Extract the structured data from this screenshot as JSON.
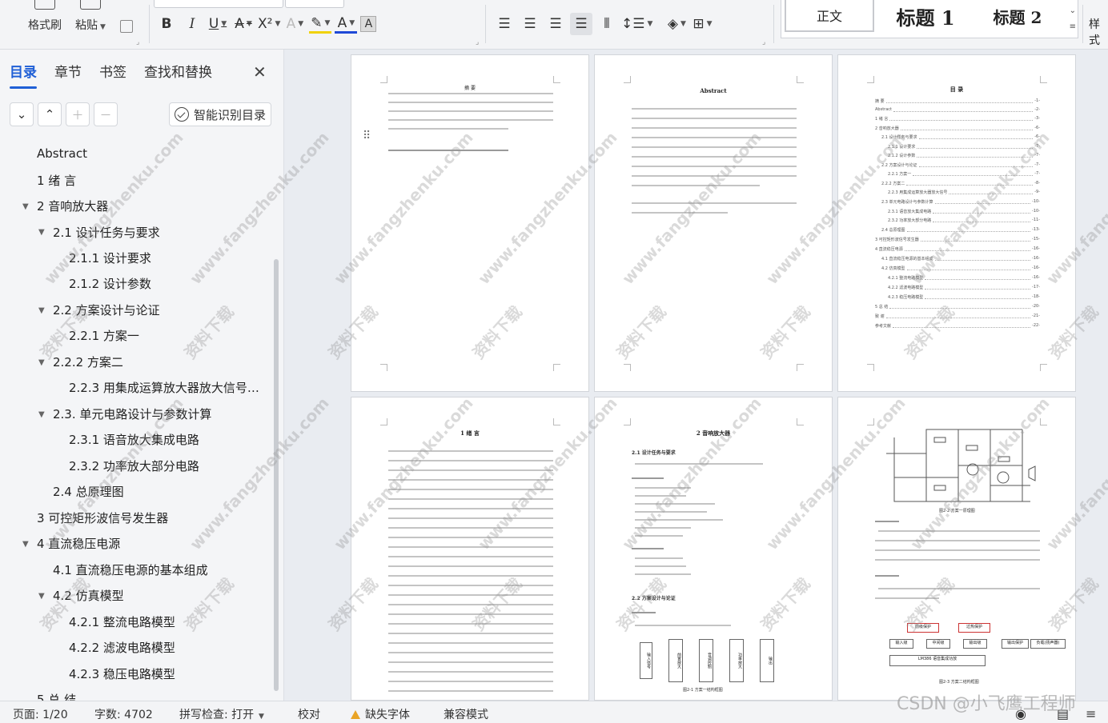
{
  "ribbon": {
    "format_painter": "格式刷",
    "paste": "粘贴",
    "font_buttons": [
      "B",
      "I",
      "U",
      "A",
      "X²",
      "A",
      "A",
      "A",
      "A"
    ],
    "styles": {
      "normal": "正文",
      "heading1": "标题 1",
      "heading2": "标题 2",
      "more": "样式"
    }
  },
  "nav": {
    "tabs": [
      "目录",
      "章节",
      "书签",
      "查找和替换"
    ],
    "smart_button": "智能识别目录",
    "toc": [
      {
        "label": "Abstract"
      },
      {
        "label": "1 绪 言"
      },
      {
        "label": "2 音响放大器"
      },
      {
        "label": "2.1 设计任务与要求"
      },
      {
        "label": "2.1.1 设计要求"
      },
      {
        "label": "2.1.2 设计参数"
      },
      {
        "label": "2.2 方案设计与论证"
      },
      {
        "label": "2.2.1 方案一"
      },
      {
        "label": "2.2.2 方案二"
      },
      {
        "label": "2.2.3 用集成运算放大器放大信号…"
      },
      {
        "label": "2.3. 单元电路设计与参数计算"
      },
      {
        "label": "2.3.1 语音放大集成电路"
      },
      {
        "label": "2.3.2 功率放大部分电路"
      },
      {
        "label": "2.4 总原理图"
      },
      {
        "label": "3 可控矩形波信号发生器"
      },
      {
        "label": "4 直流稳压电源"
      },
      {
        "label": "4.1 直流稳压电源的基本组成"
      },
      {
        "label": "4.2 仿真模型"
      },
      {
        "label": "4.2.1 整流电路模型"
      },
      {
        "label": "4.2.2 滤波电路模型"
      },
      {
        "label": "4.2.3 稳压电路模型"
      },
      {
        "label": "5 总 结"
      }
    ]
  },
  "pages": {
    "p1_title": "摘 要",
    "p2_title": "Abstract",
    "p3_title": "目 录",
    "p4_title": "1 绪 言",
    "p5_title": "2 音响放大器",
    "p5_h1": "2.1 设计任务与要求",
    "p5_h2": "2.2 方案设计与论证",
    "p5_caption": "图2-1 方案一结构框图",
    "p5_blocks": [
      "输入信号",
      "前置放大",
      "音调控制",
      "功率放大",
      "输出"
    ],
    "p6_caption1": "图2-2 方案一原理图",
    "p6_caption2": "图2-3 方案二结构框图",
    "p6_blocks": [
      "前级保护",
      "过热保护",
      "输入级",
      "中间级",
      "输出级",
      "输出保护",
      "负载(扬声器)",
      "LM386 语音集成功放"
    ],
    "p3_toc": [
      "摘 要",
      "Abstract",
      "1 绪 言",
      "2 音响放大器",
      "2.1 设计任务与要求",
      "2.1.1 设计要求",
      "2.1.2 设计参数",
      "2.2 方案设计与论证",
      "2.2.1 方案一",
      "2.2.2 方案二",
      "2.2.3 用集成运算放大器放大信号",
      "2.3 单元电路设计与参数计算",
      "2.3.1 语音放大集成电路",
      "2.3.2 功率放大部分电路",
      "2.4 总原理图",
      "3 可控矩形波信号发生器",
      "4 直流稳压电源",
      "4.1 直流稳压电源的基本组成",
      "4.2 仿真模型",
      "4.2.1 整流电路模型",
      "4.2.2 滤波电路模型",
      "4.2.3 稳压电路模型",
      "5 总 结",
      "致 谢",
      "参考文献"
    ],
    "p3_nums": [
      "-1-",
      "-2-",
      "-3-",
      "-6-",
      "-6-",
      "-7-",
      "-7-",
      "-7-",
      "-7-",
      "-8-",
      "-9-",
      "-10-",
      "-10-",
      "-11-",
      "-13-",
      "-15-",
      "-16-",
      "-16-",
      "-16-",
      "-16-",
      "-17-",
      "-18-",
      "-20-",
      "-21-",
      "-22-"
    ]
  },
  "watermark": {
    "line1": "资料下载",
    "line2": "www.fangzhenku.com"
  },
  "status": {
    "page": "页面: 1/20",
    "words": "字数: 4702",
    "spell": "拼写检查: 打开",
    "proof": "校对",
    "missing_font": "缺失字体",
    "compat": "兼容模式",
    "csdn": "CSDN @小飞鹰工程师"
  }
}
